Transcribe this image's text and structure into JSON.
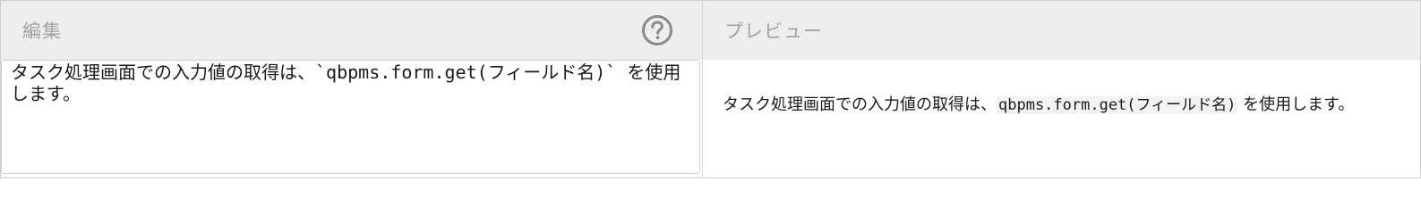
{
  "editor": {
    "title": "編集",
    "help_icon": "question-circle-icon",
    "content": "タスク処理画面での入力値の取得は、`qbpms.form.get(フィールド名)` を使用します。"
  },
  "preview": {
    "title": "プレビュー",
    "text_before": "タスク処理画面での入力値の取得は、",
    "code": "qbpms.form.get(フィールド名)",
    "text_after": " を使用します。"
  },
  "colors": {
    "header_bg": "#eeeeee",
    "header_text": "#a3a3a3",
    "icon": "#8a8a8a",
    "border": "#cfcfcf"
  }
}
